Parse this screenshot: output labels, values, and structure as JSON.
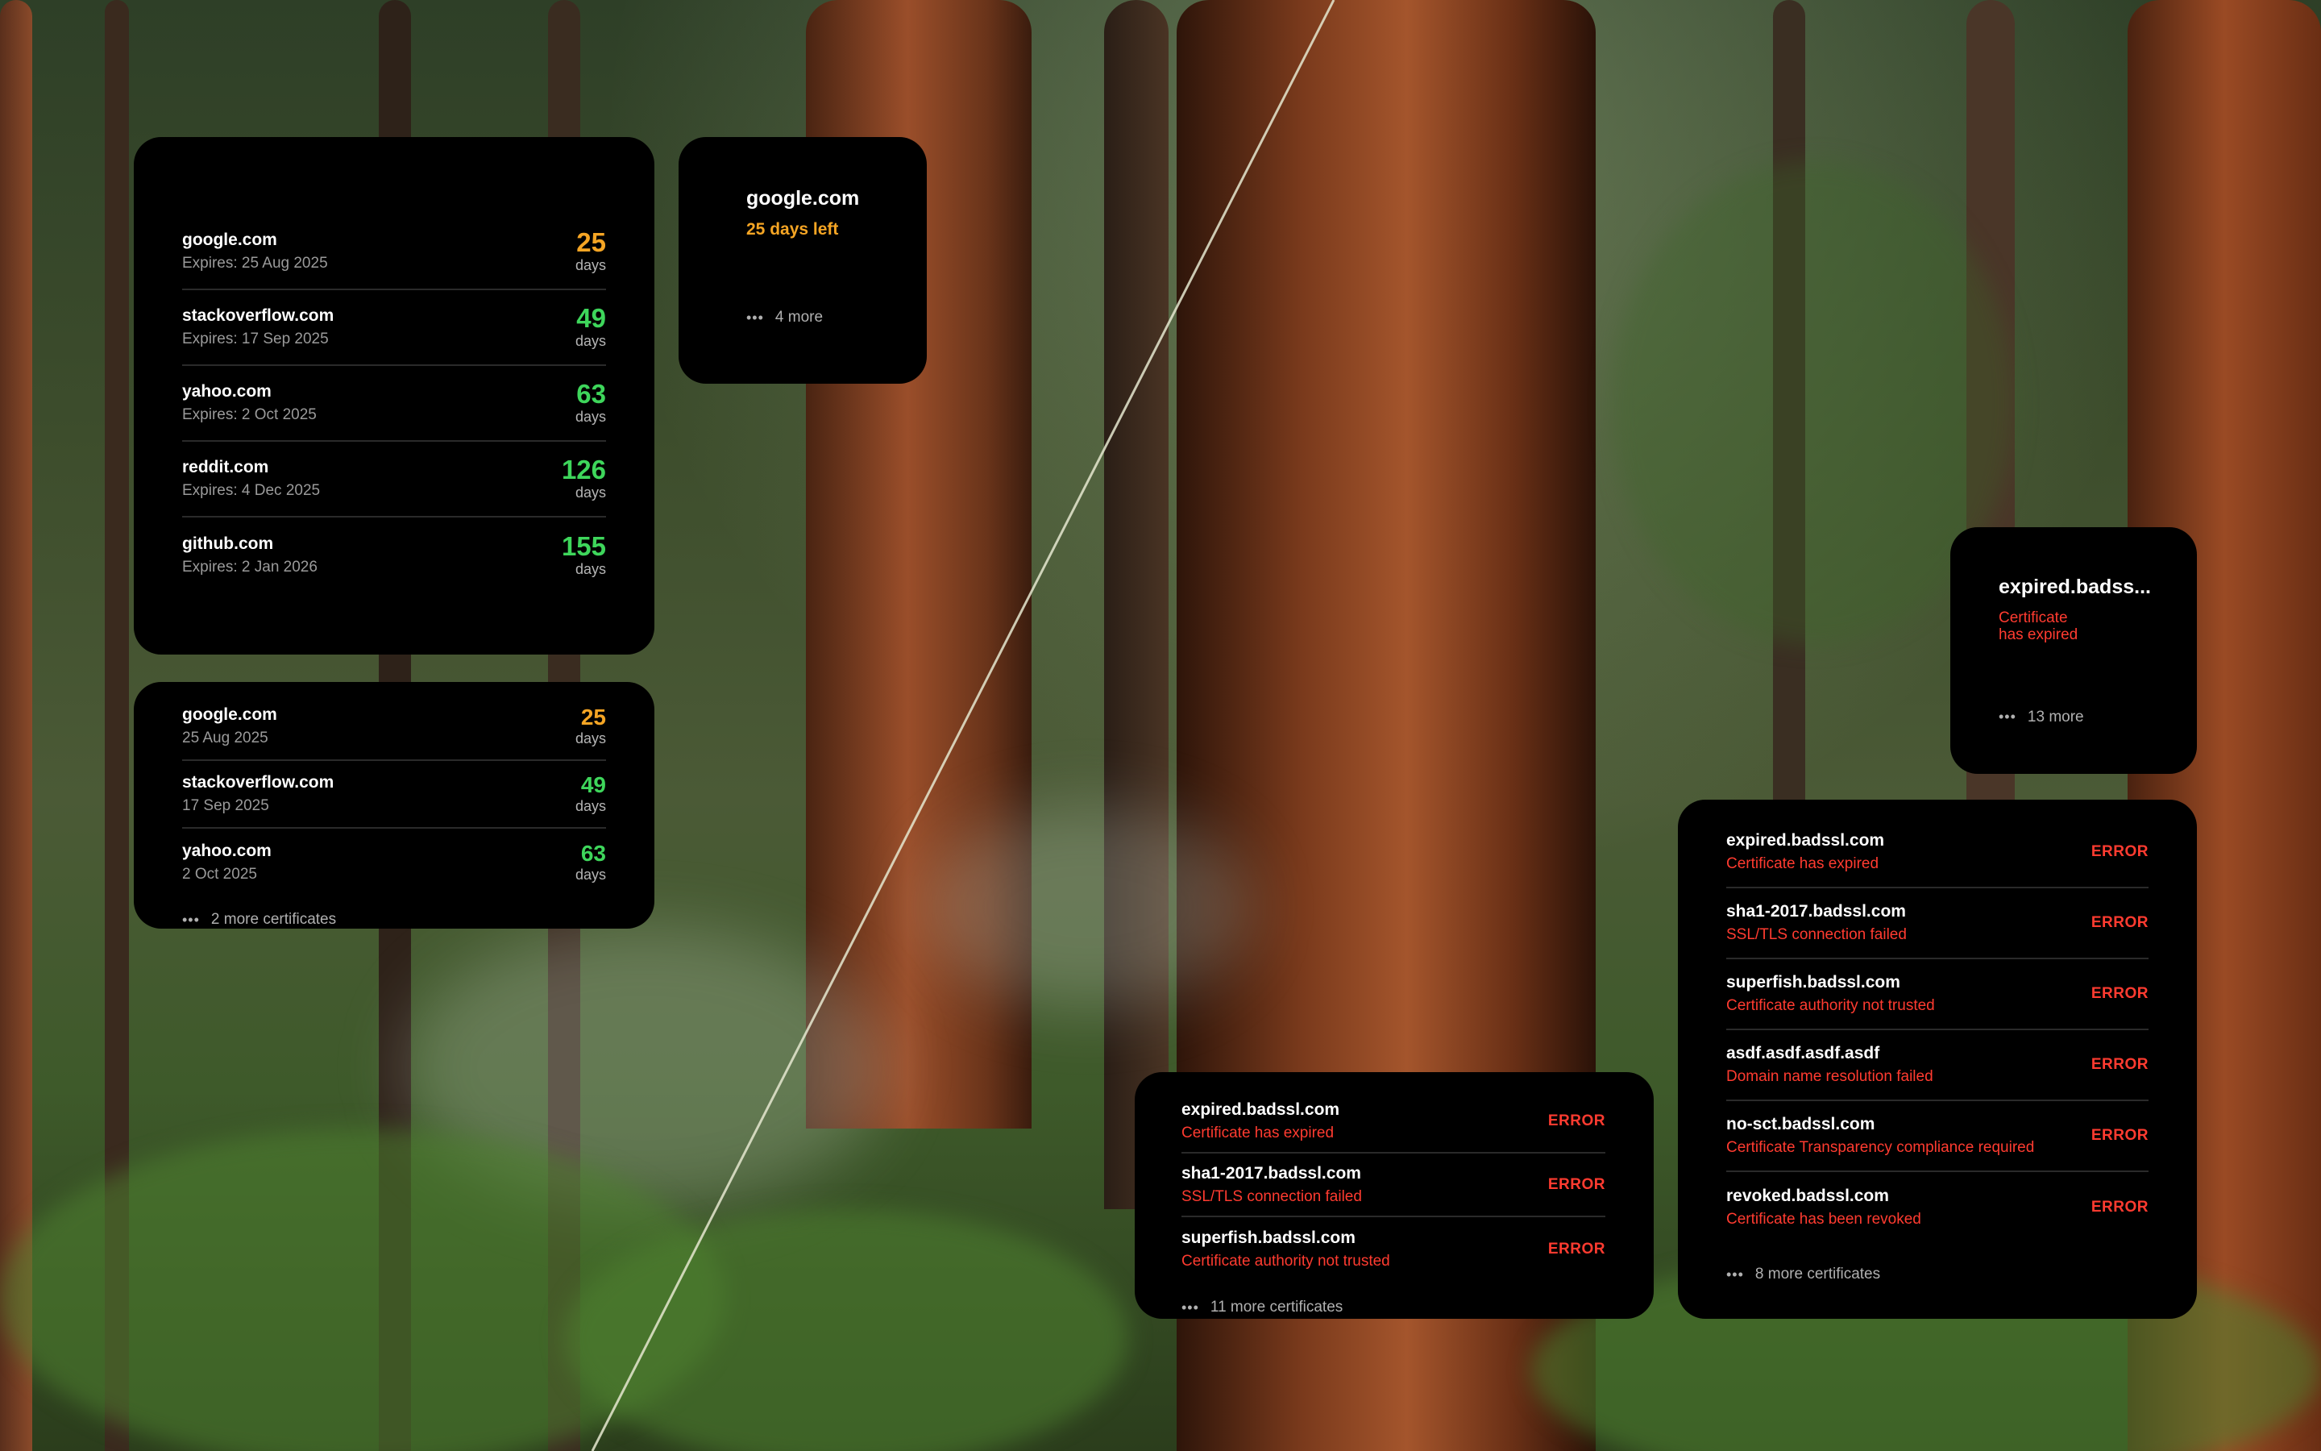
{
  "colors": {
    "orange": "#f5a524",
    "green": "#3ed65b",
    "red": "#ff3b30",
    "widget_bg": "#000000"
  },
  "widget_large_list": {
    "rows": [
      {
        "domain": "google.com",
        "expires": "Expires: 25 Aug 2025",
        "days": "25",
        "unit": "days",
        "status": "orange"
      },
      {
        "domain": "stackoverflow.com",
        "expires": "Expires: 17 Sep 2025",
        "days": "49",
        "unit": "days",
        "status": "green"
      },
      {
        "domain": "yahoo.com",
        "expires": "Expires: 2 Oct 2025",
        "days": "63",
        "unit": "days",
        "status": "green"
      },
      {
        "domain": "reddit.com",
        "expires": "Expires: 4 Dec 2025",
        "days": "126",
        "unit": "days",
        "status": "green"
      },
      {
        "domain": "github.com",
        "expires": "Expires: 2 Jan 2026",
        "days": "155",
        "unit": "days",
        "status": "green"
      }
    ]
  },
  "widget_small_single": {
    "domain": "google.com",
    "days_left": "25 days left",
    "more_icon": "ellipsis-icon",
    "more_text": "4 more"
  },
  "widget_medium_list": {
    "rows": [
      {
        "domain": "google.com",
        "date": "25 Aug 2025",
        "days": "25",
        "unit": "days",
        "status": "orange"
      },
      {
        "domain": "stackoverflow.com",
        "date": "17 Sep 2025",
        "days": "49",
        "unit": "days",
        "status": "green"
      },
      {
        "domain": "yahoo.com",
        "date": "2 Oct 2025",
        "days": "63",
        "unit": "days",
        "status": "green"
      }
    ],
    "more_text": "2 more certificates"
  },
  "widget_small_error": {
    "domain": "expired.badss...",
    "message_line1": "Certificate",
    "message_line2": "has expired",
    "more_text": "13 more"
  },
  "widget_medium_errors": {
    "rows": [
      {
        "domain": "expired.badssl.com",
        "message": "Certificate has expired",
        "badge": "ERROR"
      },
      {
        "domain": "sha1-2017.badssl.com",
        "message": "SSL/TLS connection failed",
        "badge": "ERROR"
      },
      {
        "domain": "superfish.badssl.com",
        "message": "Certificate authority not trusted",
        "badge": "ERROR"
      }
    ],
    "more_text": "11 more certificates"
  },
  "widget_large_errors": {
    "rows": [
      {
        "domain": "expired.badssl.com",
        "message": "Certificate has expired",
        "badge": "ERROR"
      },
      {
        "domain": "sha1-2017.badssl.com",
        "message": "SSL/TLS connection failed",
        "badge": "ERROR"
      },
      {
        "domain": "superfish.badssl.com",
        "message": "Certificate authority not trusted",
        "badge": "ERROR"
      },
      {
        "domain": "asdf.asdf.asdf.asdf",
        "message": "Domain name resolution failed",
        "badge": "ERROR"
      },
      {
        "domain": "no-sct.badssl.com",
        "message": "Certificate Transparency compliance required",
        "badge": "ERROR"
      },
      {
        "domain": "revoked.badssl.com",
        "message": "Certificate has been revoked",
        "badge": "ERROR"
      }
    ],
    "more_text": "8 more certificates"
  }
}
